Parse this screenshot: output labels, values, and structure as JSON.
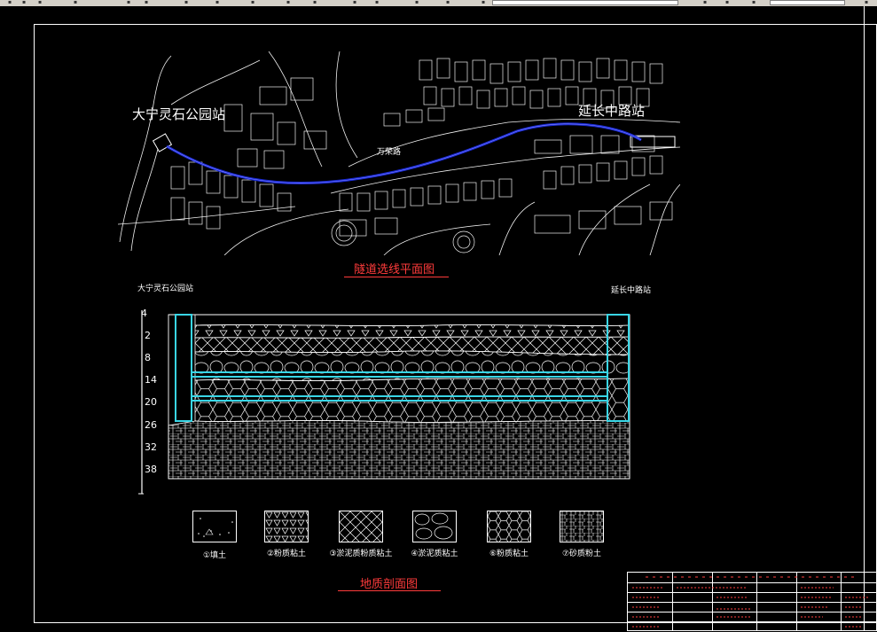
{
  "map": {
    "station_left": "大宁灵石公园站",
    "station_right": "延长中路站",
    "road_label": "万荣路",
    "title": "隧道选线平面图"
  },
  "profile": {
    "station_left": "大宁灵石公园站",
    "station_right": "延长中路站",
    "depth_ticks": [
      "4",
      "2",
      "8",
      "14",
      "20",
      "26",
      "32",
      "38"
    ],
    "title": "地质剖面图"
  },
  "legend": [
    {
      "label": "①填土",
      "pattern": "fill-dots-icon"
    },
    {
      "label": "②粉质粘土",
      "pattern": "triangles-icon"
    },
    {
      "label": "③淤泥质粉质粘土",
      "pattern": "diagonal-hatch-icon"
    },
    {
      "label": "④淤泥质粘土",
      "pattern": "pebbles-icon"
    },
    {
      "label": "⑥粉质粘土",
      "pattern": "hexagons-icon"
    },
    {
      "label": "⑦砂质粉土",
      "pattern": "grid-hatch-icon"
    }
  ],
  "colors": {
    "red": "#ff3b3b",
    "tunnel_blue": "#1a2bd6",
    "tunnel_cyan": "#39d6e6"
  }
}
